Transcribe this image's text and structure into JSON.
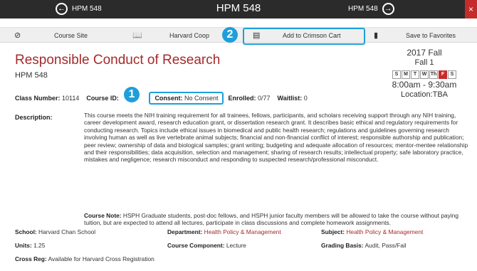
{
  "header": {
    "prev_label": "HPM 548",
    "title": "HPM 548",
    "next_label": "HPM 548",
    "close_label": "×"
  },
  "toolbar": {
    "course_site_label": "Course Site",
    "harvard_coop_label": "Harvard Coop",
    "add_to_cart_label": "Add to Crimson Cart",
    "save_favorites_label": "Save to Favorites"
  },
  "callouts": [
    "1",
    "2"
  ],
  "course": {
    "title": "Responsible Conduct of Research",
    "code": "HPM 548",
    "class_number_label": "Class Number:",
    "class_number": "10114",
    "course_id_label": "Course ID:",
    "course_id": "",
    "consent_label": "Consent:",
    "consent": "No Consent",
    "enrolled_label": "Enrolled:",
    "enrolled": "0/77",
    "waitlist_label": "Waitlist:",
    "waitlist": "0"
  },
  "term": {
    "year": "2017 Fall",
    "session": "Fall 1",
    "days": [
      "S",
      "M",
      "T",
      "W",
      "Th",
      "F",
      "S"
    ],
    "active_day": "F",
    "time": "8:00am - 9:30am",
    "location": "Location:TBA"
  },
  "description": {
    "label": "Description:",
    "text": "This course meets the NIH training requirement for all trainees, fellows, participants, and scholars receiving support through any NIH training, career development award, research education grant, or dissertation research grant. It describes basic ethical and regulatory requirements for conducting research. Topics include ethical issues in biomedical and public health research; regulations and guidelines governing research involving human as well as live vertebrate animal subjects; financial and non-financial conflict of interest; responsible authorship and publication; peer review; ownership of data and biological samples; grant writing; budgeting and adequate allocation of resources; mentor-mentee relationship and their responsibilities; data acquisition, selection and management; sharing of research results; intellectual property; safe laboratory practice, mistakes and negligence; research misconduct and responding to suspected research/professional misconduct.",
    "note_label": "Course Note:",
    "note": "HSPH Graduate students, post-doc fellows, and HSPH junior faculty members will be allowed to take the course without paying tuition, but are expected to attend all lectures, participate in class discussions and complete homework assignments."
  },
  "details": {
    "school_label": "School:",
    "school": "Harvard Chan School",
    "department_label": "Department:",
    "department": "Health Policy & Management",
    "subject_label": "Subject:",
    "subject": "Health Policy & Management",
    "units_label": "Units:",
    "units": "1.25",
    "component_label": "Course Component:",
    "component": "Lecture",
    "grading_label": "Grading Basis:",
    "grading": "Audit, Pass/Fail",
    "crossreg_label": "Cross Reg:",
    "crossreg": "Available for Harvard Cross Registration"
  },
  "colors": {
    "accent": "#1e9fd9",
    "brand": "#a52a2a",
    "header_bg": "#2b2b2b",
    "active_day": "#c62b2b"
  },
  "icons": {
    "course_site": "link-icon",
    "harvard_coop": "book-icon",
    "add_to_cart": "id-card-icon",
    "save_favorites": "bookmark-icon"
  }
}
